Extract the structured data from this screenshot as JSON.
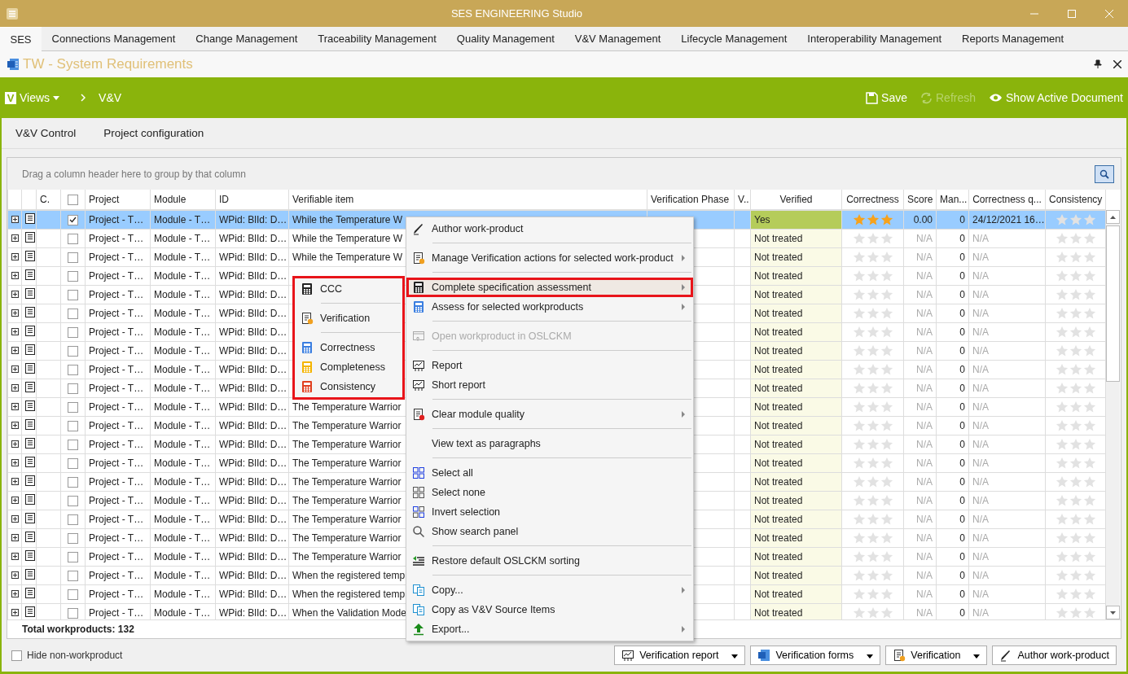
{
  "window": {
    "title": "SES ENGINEERING Studio"
  },
  "menu_tabs": [
    {
      "label": "SES",
      "selected": true
    },
    {
      "label": "Connections Management",
      "selected": false
    },
    {
      "label": "Change Management",
      "selected": false
    },
    {
      "label": "Traceability Management",
      "selected": false
    },
    {
      "label": "Quality Management",
      "selected": false
    },
    {
      "label": "V&V Management",
      "selected": false
    },
    {
      "label": "Lifecycle Management",
      "selected": false
    },
    {
      "label": "Interoperability Management",
      "selected": false
    },
    {
      "label": "Reports Management",
      "selected": false
    }
  ],
  "document": {
    "title": "TW - System Requirements"
  },
  "toolbar": {
    "views_logo": "V",
    "views_label": "Views",
    "breadcrumb": "V&V",
    "actions": [
      {
        "label": "Save",
        "disabled": false
      },
      {
        "label": "Refresh",
        "disabled": true
      },
      {
        "label": "Show Active Document",
        "disabled": false
      }
    ]
  },
  "sub_tabs": [
    "V&V Control",
    "Project configuration"
  ],
  "grid": {
    "group_hint": "Drag a column header here to group by that column",
    "select_all_checked": false,
    "columns": [
      "C.",
      "",
      "Project",
      "Module",
      "ID",
      "Verifiable item",
      "Verification Phase",
      "V..",
      "Verified",
      "Correctness",
      "Score",
      "Man...",
      "Correctness q...",
      "Consistency"
    ],
    "rows": [
      {
        "selected": true,
        "checked": true,
        "project": "Project - T…",
        "module": "Module - T…",
        "id": "WPid: BlId: D…",
        "item": "While the Temperature W",
        "verified": {
          "text": "Yes",
          "color": "#b5cc5a"
        },
        "correctness": {
          "stars": 3
        },
        "score": "0.00",
        "man": "0",
        "correctness_q": "24/12/2021 16…",
        "consistency": {
          "stars": 0
        }
      },
      {
        "selected": false,
        "checked": false,
        "project": "Project - T…",
        "module": "Module - T…",
        "id": "WPid: BlId: D…",
        "item": "While the Temperature W",
        "verified": {
          "text": "Not treated",
          "color": "#fafae6"
        },
        "correctness": {
          "stars": 0
        },
        "score": "N/A",
        "man": "0",
        "correctness_q": "N/A",
        "consistency": {
          "stars": 0
        }
      },
      {
        "selected": false,
        "checked": false,
        "project": "Project - T…",
        "module": "Module - T…",
        "id": "WPid: BlId: D…",
        "item": "While the Temperature W",
        "verified": {
          "text": "Not treated",
          "color": "#fafae6"
        },
        "correctness": {
          "stars": 0
        },
        "score": "N/A",
        "man": "0",
        "correctness_q": "N/A",
        "consistency": {
          "stars": 0
        }
      },
      {
        "selected": false,
        "checked": false,
        "project": "Project - T…",
        "module": "Module - T…",
        "id": "WPid: BlId: D…",
        "verified": {
          "text": "Not treated",
          "color": "#fafae6"
        },
        "correctness": {
          "stars": 0
        },
        "score": "N/A",
        "man": "0",
        "correctness_q": "N/A",
        "consistency": {
          "stars": 0
        }
      },
      {
        "selected": false,
        "checked": false,
        "project": "Project - T…",
        "module": "Module - T…",
        "id": "WPid: BlId: D…",
        "verified": {
          "text": "Not treated",
          "color": "#fafae6"
        },
        "correctness": {
          "stars": 0
        },
        "score": "N/A",
        "man": "0",
        "correctness_q": "N/A",
        "consistency": {
          "stars": 0
        }
      },
      {
        "selected": false,
        "checked": false,
        "project": "Project - T…",
        "module": "Module - T…",
        "id": "WPid: BlId: D…",
        "verified": {
          "text": "Not treated",
          "color": "#fafae6"
        },
        "correctness": {
          "stars": 0
        },
        "score": "N/A",
        "man": "0",
        "correctness_q": "N/A",
        "consistency": {
          "stars": 0
        }
      },
      {
        "selected": false,
        "checked": false,
        "project": "Project - T…",
        "module": "Module - T…",
        "id": "WPid: BlId: D…",
        "verified": {
          "text": "Not treated",
          "color": "#fafae6"
        },
        "correctness": {
          "stars": 0
        },
        "score": "N/A",
        "man": "0",
        "correctness_q": "N/A",
        "consistency": {
          "stars": 0
        }
      },
      {
        "selected": false,
        "checked": false,
        "project": "Project - T…",
        "module": "Module - T…",
        "id": "WPid: BlId: D…",
        "verified": {
          "text": "Not treated",
          "color": "#fafae6"
        },
        "correctness": {
          "stars": 0
        },
        "score": "N/A",
        "man": "0",
        "correctness_q": "N/A",
        "consistency": {
          "stars": 0
        }
      },
      {
        "selected": false,
        "checked": false,
        "project": "Project - T…",
        "module": "Module - T…",
        "id": "WPid: BlId: D…",
        "verified": {
          "text": "Not treated",
          "color": "#fafae6"
        },
        "correctness": {
          "stars": 0
        },
        "score": "N/A",
        "man": "0",
        "correctness_q": "N/A",
        "consistency": {
          "stars": 0
        }
      },
      {
        "selected": false,
        "checked": false,
        "project": "Project - T…",
        "module": "Module - T…",
        "id": "WPid: BlId: D…",
        "verified": {
          "text": "Not treated",
          "color": "#fafae6"
        },
        "correctness": {
          "stars": 0
        },
        "score": "N/A",
        "man": "0",
        "correctness_q": "N/A",
        "consistency": {
          "stars": 0
        }
      },
      {
        "selected": false,
        "checked": false,
        "project": "Project - T…",
        "module": "Module - T…",
        "id": "WPid: BlId: D…",
        "item": "The Temperature Warrior",
        "verified": {
          "text": "Not treated",
          "color": "#fafae6"
        },
        "correctness": {
          "stars": 0
        },
        "score": "N/A",
        "man": "0",
        "correctness_q": "N/A",
        "consistency": {
          "stars": 0
        }
      },
      {
        "selected": false,
        "checked": false,
        "project": "Project - T…",
        "module": "Module - T…",
        "id": "WPid: BlId: D…",
        "item": "The Temperature Warrior",
        "verified": {
          "text": "Not treated",
          "color": "#fafae6"
        },
        "correctness": {
          "stars": 0
        },
        "score": "N/A",
        "man": "0",
        "correctness_q": "N/A",
        "consistency": {
          "stars": 0
        }
      },
      {
        "selected": false,
        "checked": false,
        "project": "Project - T…",
        "module": "Module - T…",
        "id": "WPid: BlId: D…",
        "item": "The Temperature Warrior",
        "verified": {
          "text": "Not treated",
          "color": "#fafae6"
        },
        "correctness": {
          "stars": 0
        },
        "score": "N/A",
        "man": "0",
        "correctness_q": "N/A",
        "consistency": {
          "stars": 0
        }
      },
      {
        "selected": false,
        "checked": false,
        "project": "Project - T…",
        "module": "Module - T…",
        "id": "WPid: BlId: D…",
        "item": "The Temperature Warrior",
        "verified": {
          "text": "Not treated",
          "color": "#fafae6"
        },
        "correctness": {
          "stars": 0
        },
        "score": "N/A",
        "man": "0",
        "correctness_q": "N/A",
        "consistency": {
          "stars": 0
        }
      },
      {
        "selected": false,
        "checked": false,
        "project": "Project - T…",
        "module": "Module - T…",
        "id": "WPid: BlId: D…",
        "item": "The Temperature Warrior",
        "verified": {
          "text": "Not treated",
          "color": "#fafae6"
        },
        "correctness": {
          "stars": 0
        },
        "score": "N/A",
        "man": "0",
        "correctness_q": "N/A",
        "consistency": {
          "stars": 0
        }
      },
      {
        "selected": false,
        "checked": false,
        "project": "Project - T…",
        "module": "Module - T…",
        "id": "WPid: BlId: D…",
        "item": "The Temperature Warrior",
        "verified": {
          "text": "Not treated",
          "color": "#fafae6"
        },
        "correctness": {
          "stars": 0
        },
        "score": "N/A",
        "man": "0",
        "correctness_q": "N/A",
        "consistency": {
          "stars": 0
        }
      },
      {
        "selected": false,
        "checked": false,
        "project": "Project - T…",
        "module": "Module - T…",
        "id": "WPid: BlId: D…",
        "item": "The Temperature Warrior",
        "verified": {
          "text": "Not treated",
          "color": "#fafae6"
        },
        "correctness": {
          "stars": 0
        },
        "score": "N/A",
        "man": "0",
        "correctness_q": "N/A",
        "consistency": {
          "stars": 0
        }
      },
      {
        "selected": false,
        "checked": false,
        "project": "Project - T…",
        "module": "Module - T…",
        "id": "WPid: BlId: D…",
        "item": "The Temperature Warrior",
        "verified": {
          "text": "Not treated",
          "color": "#fafae6"
        },
        "correctness": {
          "stars": 0
        },
        "score": "N/A",
        "man": "0",
        "correctness_q": "N/A",
        "consistency": {
          "stars": 0
        }
      },
      {
        "selected": false,
        "checked": false,
        "project": "Project - T…",
        "module": "Module - T…",
        "id": "WPid: BlId: D…",
        "item": "The Temperature Warrior",
        "verified": {
          "text": "Not treated",
          "color": "#fafae6"
        },
        "correctness": {
          "stars": 0
        },
        "score": "N/A",
        "man": "0",
        "correctness_q": "N/A",
        "consistency": {
          "stars": 0
        }
      },
      {
        "selected": false,
        "checked": false,
        "project": "Project - T…",
        "module": "Module - T…",
        "id": "WPid: BlId: D…",
        "item": "When the registered temp",
        "verified": {
          "text": "Not treated",
          "color": "#fafae6"
        },
        "correctness": {
          "stars": 0
        },
        "score": "N/A",
        "man": "0",
        "correctness_q": "N/A",
        "consistency": {
          "stars": 0
        }
      },
      {
        "selected": false,
        "checked": false,
        "project": "Project - T…",
        "module": "Module - T…",
        "id": "WPid: BlId: D…",
        "item": "When the registered temp",
        "verified": {
          "text": "Not treated",
          "color": "#fafae6"
        },
        "correctness": {
          "stars": 0
        },
        "score": "N/A",
        "man": "0",
        "correctness_q": "N/A",
        "consistency": {
          "stars": 0
        }
      },
      {
        "selected": false,
        "checked": false,
        "project": "Project - T…",
        "module": "Module - T…",
        "id": "WPid: BlId: D…",
        "item": "When the Validation Mode",
        "verified": {
          "text": "Not treated",
          "color": "#fafae6"
        },
        "correctness": {
          "stars": 0
        },
        "score": "N/A",
        "man": "0",
        "correctness_q": "N/A",
        "consistency": {
          "stars": 0
        }
      }
    ],
    "total": "Total workproducts: 132"
  },
  "context_menu": {
    "items": [
      {
        "kind": "item",
        "label": "Author work-product",
        "submenu": false,
        "disabled": false,
        "selected": false
      },
      {
        "kind": "separator"
      },
      {
        "kind": "item",
        "label": "Manage Verification actions for selected work-product",
        "submenu": true,
        "disabled": false,
        "selected": false
      },
      {
        "kind": "separator"
      },
      {
        "kind": "item",
        "label": "Complete specification assessment",
        "submenu": true,
        "disabled": false,
        "selected": true
      },
      {
        "kind": "item",
        "label": "Assess for selected workproducts",
        "submenu": true,
        "disabled": false,
        "selected": false
      },
      {
        "kind": "separator"
      },
      {
        "kind": "item",
        "label": "Open workproduct in OSLCKM",
        "submenu": false,
        "disabled": true,
        "selected": false
      },
      {
        "kind": "separator"
      },
      {
        "kind": "item",
        "label": "Report",
        "submenu": false,
        "disabled": false,
        "selected": false
      },
      {
        "kind": "item",
        "label": "Short report",
        "submenu": false,
        "disabled": false,
        "selected": false
      },
      {
        "kind": "separator"
      },
      {
        "kind": "item",
        "label": "Clear module quality",
        "submenu": true,
        "disabled": false,
        "selected": false
      },
      {
        "kind": "separator"
      },
      {
        "kind": "item",
        "label": "View text as paragraphs",
        "submenu": false,
        "disabled": false,
        "selected": false
      },
      {
        "kind": "separator"
      },
      {
        "kind": "item",
        "label": "Select all",
        "submenu": false,
        "disabled": false,
        "selected": false
      },
      {
        "kind": "item",
        "label": "Select none",
        "submenu": false,
        "disabled": false,
        "selected": false
      },
      {
        "kind": "item",
        "label": "Invert selection",
        "submenu": false,
        "disabled": false,
        "selected": false
      },
      {
        "kind": "item",
        "label": "Show search panel",
        "submenu": false,
        "disabled": false,
        "selected": false
      },
      {
        "kind": "separator"
      },
      {
        "kind": "item",
        "label": "Restore default OSLCKM sorting",
        "submenu": false,
        "disabled": false,
        "selected": false
      },
      {
        "kind": "separator"
      },
      {
        "kind": "item",
        "label": "Copy...",
        "submenu": true,
        "disabled": false,
        "selected": false
      },
      {
        "kind": "item",
        "label": "Copy as V&V Source Items",
        "submenu": false,
        "disabled": false,
        "selected": false
      },
      {
        "kind": "item",
        "label": "Export...",
        "submenu": true,
        "disabled": false,
        "selected": false
      }
    ]
  },
  "submenu": {
    "items": [
      {
        "kind": "item",
        "label": "CCC"
      },
      {
        "kind": "separator"
      },
      {
        "kind": "item",
        "label": "Verification"
      },
      {
        "kind": "separator"
      },
      {
        "kind": "item",
        "label": "Correctness"
      },
      {
        "kind": "item",
        "label": "Completeness"
      },
      {
        "kind": "item",
        "label": "Consistency"
      }
    ]
  },
  "footer": {
    "hide_non_workproduct": {
      "label": "Hide non-workproduct",
      "checked": false
    },
    "buttons": [
      {
        "label": "Verification report",
        "dropdown": true
      },
      {
        "label": "Verification forms",
        "dropdown": true
      },
      {
        "label": "Verification",
        "dropdown": true
      },
      {
        "label": "Author work-product",
        "dropdown": false
      }
    ]
  }
}
